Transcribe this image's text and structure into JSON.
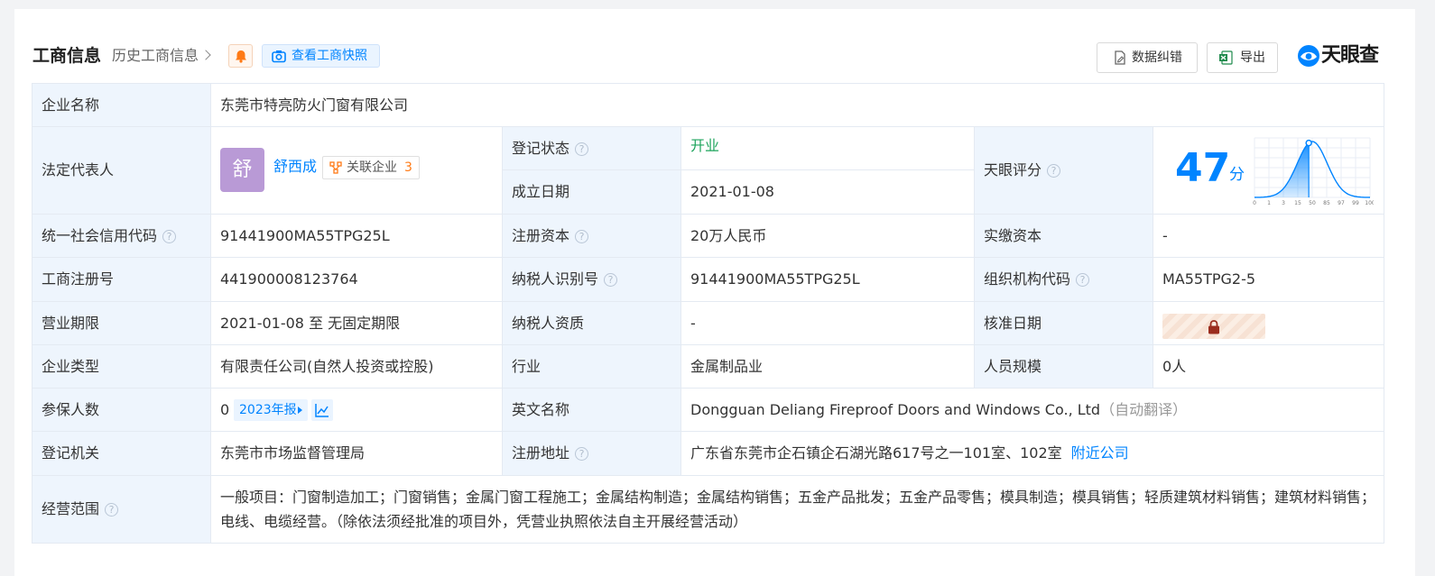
{
  "header": {
    "title": "工商信息",
    "history_link": "历史工商信息",
    "snapshot_button": "查看工商快照",
    "correction_button": "数据纠错",
    "export_button": "导出",
    "brand": "天眼查"
  },
  "table": {
    "company_name_label": "企业名称",
    "company_name": "东莞市特亮防火门窗有限公司",
    "legal_rep_label": "法定代表人",
    "legal_rep_avatar": "舒",
    "legal_rep_name": "舒西成",
    "related_label": "关联企业",
    "related_count": "3",
    "reg_status_label": "登记状态",
    "reg_status": "开业",
    "founded_label": "成立日期",
    "founded": "2021-01-08",
    "tianyan_score_label": "天眼评分",
    "score": "47",
    "score_unit": "分",
    "score_fraction": 0.47,
    "score_axis_ticks": [
      "0",
      "1",
      "3",
      "15",
      "50",
      "85",
      "97",
      "99",
      "100"
    ],
    "credit_code_label": "统一社会信用代码",
    "credit_code": "91441900MA55TPG25L",
    "reg_capital_label": "注册资本",
    "reg_capital": "20万人民币",
    "paid_capital_label": "实缴资本",
    "paid_capital": "-",
    "biz_reg_no_label": "工商注册号",
    "biz_reg_no": "441900008123764",
    "taxpayer_id_label": "纳税人识别号",
    "taxpayer_id": "91441900MA55TPG25L",
    "org_code_label": "组织机构代码",
    "org_code": "MA55TPG2-5",
    "biz_term_label": "营业期限",
    "biz_term": "2021-01-08 至 无固定期限",
    "taxpayer_qual_label": "纳税人资质",
    "taxpayer_qual": "-",
    "approval_date_label": "核准日期",
    "company_type_label": "企业类型",
    "company_type": "有限责任公司(自然人投资或控股)",
    "industry_label": "行业",
    "industry": "金属制品业",
    "staff_size_label": "人员规模",
    "staff_size": "0人",
    "insured_label": "参保人数",
    "insured": "0",
    "insured_report": "2023年报",
    "english_name_label": "英文名称",
    "english_name": "Dongguan Deliang Fireproof Doors and Windows Co., Ltd",
    "auto_translate": "（自动翻译）",
    "reg_authority_label": "登记机关",
    "reg_authority": "东莞市市场监督管理局",
    "reg_address_label": "注册地址",
    "reg_address": "广东省东莞市企石镇企石湖光路617号之一101室、102室",
    "nearby_link": "附近公司",
    "scope_label": "经营范围",
    "scope": "一般项目：门窗制造加工；门窗销售；金属门窗工程施工；金属结构制造；金属结构销售；五金产品批发；五金产品零售；模具制造；模具销售；轻质建筑材料销售；建筑材料销售；电线、电缆经营。（除依法须经批准的项目外，凭营业执照依法自主开展经营活动）"
  },
  "colors": {
    "accent": "#0084ff",
    "status_green": "#1ea45c",
    "label_bg": "#eef5fd",
    "avatar_bg": "#b99ad6",
    "related_count": "#ff7a16"
  }
}
